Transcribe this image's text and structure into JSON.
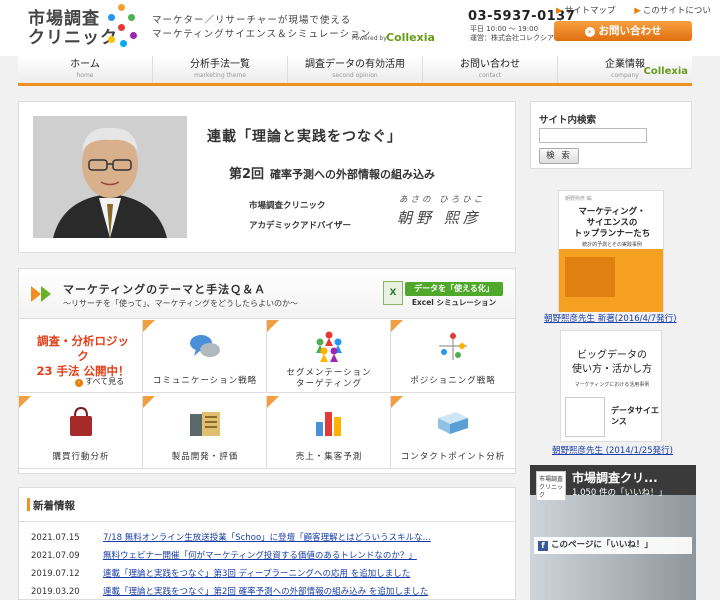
{
  "header": {
    "logo_line1": "市場調査",
    "logo_line2": "クリニック",
    "tagline1": "マーケター／リサーチャーが現場で使える",
    "tagline2": "マーケティングサイエンス＆シミュレーション",
    "powered_by": "Powered by",
    "collexia": "Collexia",
    "phone": "03-5937-0137",
    "hours1": "平日 10:00 〜 19:00",
    "hours2": "運営：株式会社コレクシア",
    "sitemap": "サイトマップ",
    "about": "このサイトについて",
    "contact_button": "お問い合わせ"
  },
  "nav": [
    {
      "label": "ホーム",
      "sub": "home"
    },
    {
      "label": "分析手法一覧",
      "sub": "marketing theme"
    },
    {
      "label": "調査データの有効活用",
      "sub": "second opinion"
    },
    {
      "label": "お問い合わせ",
      "sub": "contact"
    },
    {
      "label": "企業情報",
      "sub": "company",
      "brand": "Collexia"
    }
  ],
  "feature": {
    "title": "連載「理論と実践をつなぐ」",
    "episode": "第2回",
    "episode_title": "確率予測への外部情報の組み込み",
    "org1": "市場調査クリニック",
    "org2": "アカデミックアドバイザー",
    "kana": "あさの ひろひこ",
    "name": "朝野 熙彦"
  },
  "marketing": {
    "title": "マーケティングのテーマと手法Ｑ＆Ａ",
    "subtitle": "〜リサーチを「使って」、マーケティングをどうしたらよいのか〜",
    "excel_badge": "データを「使える化」",
    "excel_text": "Excel シミュレーション",
    "promo_line1": "調査・分析ロジック",
    "promo_line2": "23 手法 公開中！",
    "promo_link": "すべて見る",
    "cells": [
      {
        "label": "コミュニケーション戦略"
      },
      {
        "label1": "セグメンテーション",
        "label2": "ターゲティング"
      },
      {
        "label": "ポジショニング戦略"
      },
      {
        "label": "購買行動分析"
      },
      {
        "label": "製品開発・評価"
      },
      {
        "label": "売上・集客予測"
      },
      {
        "label": "コンタクトポイント分析"
      }
    ]
  },
  "news": {
    "title": "新着情報",
    "items": [
      {
        "date": "2021.07.15",
        "text": "7/18 無料オンライン生放送授業「Schoo」に登壇「顧客理解とはどういうスキルな..."
      },
      {
        "date": "2021.07.09",
        "text": "無料ウェビナー開催「何がマーケティング投資する価値のあるトレンドなのか？」"
      },
      {
        "date": "2019.07.12",
        "text": "連載「理論と実践をつなぐ」第3回 ディープラーニングへの応用 を追加しました"
      },
      {
        "date": "2019.03.20",
        "text": "連載「理論と実践をつなぐ」第2回 確率予測への外部情報の組み込み を追加しました"
      }
    ]
  },
  "sidebar": {
    "search_title": "サイト内検索",
    "search_placeholder": "",
    "search_button": "検 索",
    "book1_caption": "朝野熙彦先生 新著(2016/4/7発行)",
    "book1_title1": "マーケティング・",
    "book1_title2": "サイエンスの",
    "book1_title3": "トップランナーたち",
    "book1_sub": "統計的予測とその実践事例",
    "book2_caption": "朝野熙彦先生 (2014/1/25発行)",
    "book2_title1": "ビッグデータの",
    "book2_title2": "使い方・活かし方",
    "book2_sub": "マーケティングにおける活用事例",
    "book2_tag": "データサイエンス",
    "fb_logo": "市場調査クリニック",
    "fb_title": "市場調査クリ...",
    "fb_likes": "1,050 件の「いいね！」",
    "fb_like_bar": "このページに「いいね！」"
  },
  "colors": {
    "accent_orange": "#f09020",
    "link_blue": "#1a3ea8",
    "promo_red": "#e0401a",
    "brand_green": "#6a9a1a"
  }
}
